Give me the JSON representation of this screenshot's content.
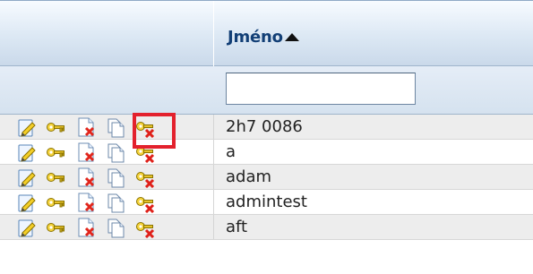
{
  "table": {
    "column_title": "Jméno",
    "sort": "ascending",
    "filter": {
      "value": "",
      "placeholder": ""
    },
    "rows": [
      {
        "name": "2h7 0086"
      },
      {
        "name": "a"
      },
      {
        "name": "adam"
      },
      {
        "name": "admintest"
      },
      {
        "name": "aft"
      }
    ],
    "row_actions": [
      "edit-icon",
      "key-icon",
      "delete-document-icon",
      "copy-icon",
      "remove-key-icon"
    ]
  },
  "colors": {
    "header_text": "#123f76",
    "highlight": "#e3212d",
    "alternate_row": "#ededed"
  }
}
